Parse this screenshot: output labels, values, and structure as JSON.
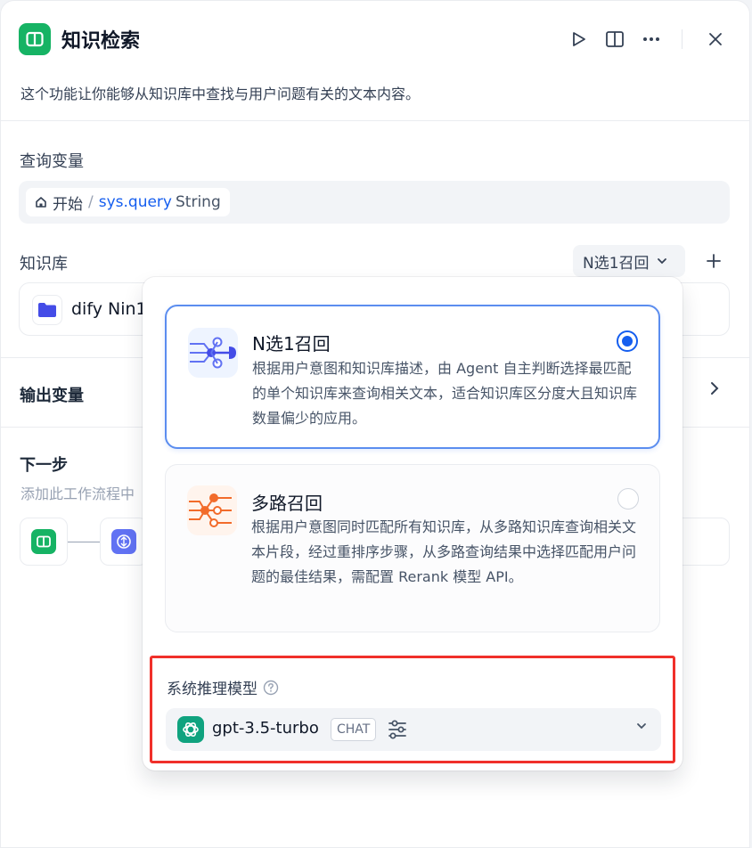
{
  "header": {
    "title": "知识检索",
    "description": "这个功能让你能够从知识库中查找与用户问题有关的文本内容。"
  },
  "query_variable": {
    "label": "查询变量",
    "node": "开始",
    "separator": "/",
    "variable": "sys.query",
    "type": "String"
  },
  "knowledge": {
    "label": "知识库",
    "mode_select": "N选1召回",
    "item_name": "dify Nin1"
  },
  "output": {
    "label": "输出变量"
  },
  "next_step": {
    "label": "下一步",
    "description": "添加此工作流程中"
  },
  "popup": {
    "options": [
      {
        "title": "N选1召回",
        "description": "根据用户意图和知识库描述，由 Agent 自主判断选择最匹配的单个知识库来查询相关文本，适合知识库区分度大且知识库数量偏少的应用。",
        "selected": true
      },
      {
        "title": "多路召回",
        "description": "根据用户意图同时匹配所有知识库，从多路知识库查询相关文本片段，经过重排序步骤，从多路查询结果中选择匹配用户问题的最佳结果，需配置 Rerank 模型 API。",
        "selected": false
      }
    ],
    "model": {
      "label": "系统推理模型",
      "name": "gpt-3.5-turbo",
      "badge": "CHAT"
    }
  },
  "colors": {
    "accent": "#155eef",
    "app_icon": "#16b364",
    "highlight_border": "#f0302a",
    "openai_logo": "#10a37f",
    "multi_path_icon": "#f26b2a"
  }
}
